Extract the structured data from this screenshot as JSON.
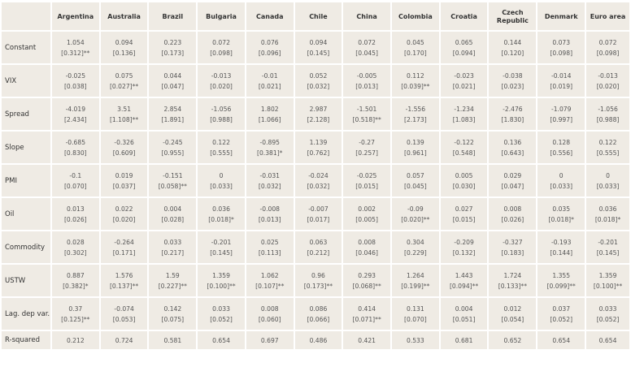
{
  "columns": [
    "Argentina",
    "Australia",
    "Brazil",
    "Bulgaria",
    "Canada",
    "Chile",
    "China",
    "Colombia",
    "Croatia",
    "Czech Republic",
    "Denmark",
    "Euro area"
  ],
  "rows": [
    {
      "label": "Constant",
      "coef": [
        "1.054",
        "0.094",
        "0.223",
        "0.072",
        "0.076",
        "0.094",
        "0.072",
        "0.045",
        "0.065",
        "0.144",
        "0.073",
        "0.072"
      ],
      "se": [
        "[0.312]**",
        "[0.136]",
        "[0.173]",
        "[0.098]",
        "[0.096]",
        "[0.145]",
        "[0.045]",
        "[0.170]",
        "[0.094]",
        "[0.120]",
        "[0.098]",
        "[0.098]"
      ]
    },
    {
      "label": "VIX",
      "coef": [
        "-0.025",
        "0.075",
        "0.044",
        "-0.013",
        "-0.01",
        "0.052",
        "-0.005",
        "0.112",
        "-0.023",
        "-0.038",
        "-0.014",
        "-0.013"
      ],
      "se": [
        "[0.038]",
        "[0.027]**",
        "[0.047]",
        "[0.020]",
        "[0.021]",
        "[0.032]",
        "[0.013]",
        "[0.039]**",
        "[0.021]",
        "[0.023]",
        "[0.019]",
        "[0.020]"
      ]
    },
    {
      "label": "Spread",
      "coef": [
        "-4.019",
        "3.51",
        "2.854",
        "-1.056",
        "1.802",
        "2.987",
        "-1.501",
        "-1.556",
        "-1.234",
        "-2.476",
        "-1.079",
        "-1.056"
      ],
      "se": [
        "[2.434]",
        "[1.108]**",
        "[1.891]",
        "[0.988]",
        "[1.066]",
        "[2.128]",
        "[0.518]**",
        "[2.173]",
        "[1.083]",
        "[1.830]",
        "[0.997]",
        "[0.988]"
      ]
    },
    {
      "label": "Slope",
      "coef": [
        "-0.685",
        "-0.326",
        "-0.245",
        "0.122",
        "-0.895",
        "1.139",
        "-0.27",
        "0.139",
        "-0.122",
        "0.136",
        "0.128",
        "0.122"
      ],
      "se": [
        "[0.830]",
        "[0.609]",
        "[0.955]",
        "[0.555]",
        "[0.381]*",
        "[0.762]",
        "[0.257]",
        "[0.961]",
        "[0.548]",
        "[0.643]",
        "[0.556]",
        "[0.555]"
      ]
    },
    {
      "label": "PMI",
      "coef": [
        "-0.1",
        "0.019",
        "-0.151",
        "0",
        "-0.031",
        "-0.024",
        "-0.025",
        "0.057",
        "0.005",
        "0.029",
        "0",
        "0"
      ],
      "se": [
        "[0.070]",
        "[0.037]",
        "[0.058]**",
        "[0.033]",
        "[0.032]",
        "[0.032]",
        "[0.015]",
        "[0.045]",
        "[0.030]",
        "[0.047]",
        "[0.033]",
        "[0.033]"
      ]
    },
    {
      "label": "Oil",
      "coef": [
        "0.013",
        "0.022",
        "0.004",
        "0.036",
        "-0.008",
        "-0.007",
        "0.002",
        "-0.09",
        "0.027",
        "0.008",
        "0.035",
        "0.036"
      ],
      "se": [
        "[0.026]",
        "[0.020]",
        "[0.028]",
        "[0.018]*",
        "[0.013]",
        "[0.017]",
        "[0.005]",
        "[0.020]**",
        "[0.015]",
        "[0.026]",
        "[0.018]*",
        "[0.018]*"
      ]
    },
    {
      "label": "Commodity",
      "coef": [
        "0.028",
        "-0.264",
        "0.033",
        "-0.201",
        "0.025",
        "0.063",
        "0.008",
        "0.304",
        "-0.209",
        "-0.327",
        "-0.193",
        "-0.201"
      ],
      "se": [
        "[0.302]",
        "[0.171]",
        "[0.217]",
        "[0.145]",
        "[0.113]",
        "[0.212]",
        "[0.046]",
        "[0.229]",
        "[0.132]",
        "[0.183]",
        "[0.144]",
        "[0.145]"
      ]
    },
    {
      "label": "USTW",
      "coef": [
        "0.887",
        "1.576",
        "1.59",
        "1.359",
        "1.062",
        "0.96",
        "0.293",
        "1.264",
        "1.443",
        "1.724",
        "1.355",
        "1.359"
      ],
      "se": [
        "[0.382]*",
        "[0.137]**",
        "[0.227]**",
        "[0.100]**",
        "[0.107]**",
        "[0.173]**",
        "[0.068]**",
        "[0.199]**",
        "[0.094]**",
        "[0.133]**",
        "[0.099]**",
        "[0.100]**"
      ]
    },
    {
      "label": "Lag. dep var.",
      "coef": [
        "0.37",
        "-0.074",
        "0.142",
        "0.033",
        "0.008",
        "0.086",
        "0.414",
        "0.131",
        "0.004",
        "0.012",
        "0.037",
        "0.033"
      ],
      "se": [
        "[0.125]**",
        "[0.053]",
        "[0.075]",
        "[0.052]",
        "[0.060]",
        "[0.066]",
        "[0.071]**",
        "[0.070]",
        "[0.051]",
        "[0.054]",
        "[0.052]",
        "[0.052]"
      ]
    }
  ],
  "rsquared": {
    "label": "R-squared",
    "values": [
      "0.212",
      "0.724",
      "0.581",
      "0.654",
      "0.697",
      "0.486",
      "0.421",
      "0.533",
      "0.681",
      "0.652",
      "0.654",
      "0.654"
    ]
  }
}
